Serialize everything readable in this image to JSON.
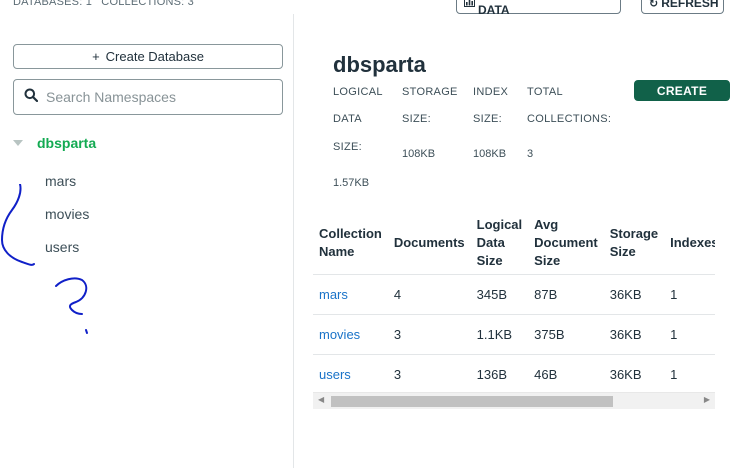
{
  "header": {
    "databases_label": "DATABASES: 1",
    "collections_label": "COLLECTIONS: 3",
    "visualize_label": "VISUALIZE YOUR DATA",
    "refresh_label": "REFRESH"
  },
  "sidebar": {
    "create_db_label": "Create Database",
    "search_placeholder": "Search Namespaces",
    "database": "dbsparta",
    "collections": [
      "mars",
      "movies",
      "users"
    ]
  },
  "main": {
    "db_title": "dbsparta",
    "create_label": "CREATE",
    "stats": {
      "logical": {
        "labels": [
          "LOGICAL",
          "DATA",
          "SIZE:"
        ],
        "value": "1.57KB"
      },
      "storage": {
        "labels": [
          "STORAGE",
          "SIZE:"
        ],
        "value": "108KB"
      },
      "index": {
        "labels": [
          "INDEX",
          "SIZE:"
        ],
        "value": "108KB"
      },
      "total": {
        "labels": [
          "TOTAL",
          "COLLECTIONS:"
        ],
        "value": "3"
      }
    },
    "table": {
      "headers": [
        [
          "Collection",
          "Name"
        ],
        [
          "Documents"
        ],
        [
          "Logical",
          "Data",
          "Size"
        ],
        [
          "Avg",
          "Document",
          "Size"
        ],
        [
          "Storage",
          "Size"
        ],
        [
          "Indexes"
        ]
      ],
      "rows": [
        [
          "mars",
          "4",
          "345B",
          "87B",
          "36KB",
          "1"
        ],
        [
          "movies",
          "3",
          "1.1KB",
          "375B",
          "36KB",
          "1"
        ],
        [
          "users",
          "3",
          "136B",
          "46B",
          "36KB",
          "1"
        ]
      ]
    }
  },
  "colors": {
    "brand_green": "#13aa52",
    "create_button": "#116149",
    "link_blue": "#1a73c8",
    "annotation_ink": "#1020c8"
  }
}
